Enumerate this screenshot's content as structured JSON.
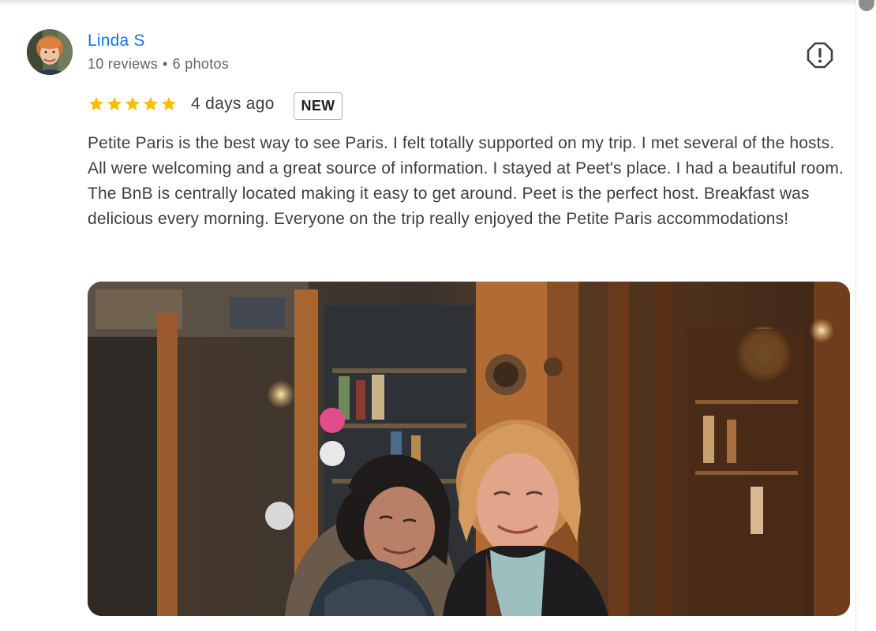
{
  "reviewer": {
    "name": "Linda S",
    "reviews_count": "10 reviews",
    "separator": "•",
    "photos_count": "6 photos"
  },
  "review": {
    "rating": 5,
    "rating_max": 5,
    "date": "4 days ago",
    "badge": "NEW",
    "text": "Petite Paris is the best way to see Paris. I felt totally supported on my trip. I met several of the hosts. All were welcoming and a great source of information. I stayed at Peet's place. I had a beautiful room. The BnB is centrally located making it easy to get around. Peet is the perfect host. Breakfast was delicious every morning. Everyone on the trip really enjoyed the Petite Paris accommodations!"
  },
  "icons": {
    "report": "report-icon",
    "star": "star-icon"
  },
  "colors": {
    "name_link": "#1a73e8",
    "star": "#fbbc04",
    "meta_text": "#5f6368",
    "body_text": "#3c4043"
  }
}
